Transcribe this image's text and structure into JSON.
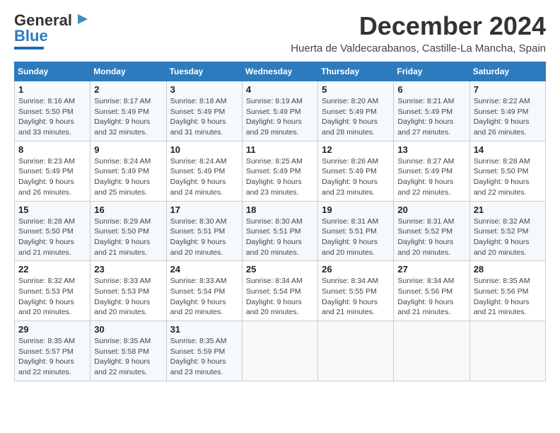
{
  "logo": {
    "line1": "General",
    "line2": "Blue"
  },
  "title": "December 2024",
  "subtitle": "Huerta de Valdecarabanos, Castille-La Mancha, Spain",
  "days_of_week": [
    "Sunday",
    "Monday",
    "Tuesday",
    "Wednesday",
    "Thursday",
    "Friday",
    "Saturday"
  ],
  "weeks": [
    [
      {
        "day": "1",
        "info": "Sunrise: 8:16 AM\nSunset: 5:50 PM\nDaylight: 9 hours\nand 33 minutes."
      },
      {
        "day": "2",
        "info": "Sunrise: 8:17 AM\nSunset: 5:49 PM\nDaylight: 9 hours\nand 32 minutes."
      },
      {
        "day": "3",
        "info": "Sunrise: 8:18 AM\nSunset: 5:49 PM\nDaylight: 9 hours\nand 31 minutes."
      },
      {
        "day": "4",
        "info": "Sunrise: 8:19 AM\nSunset: 5:49 PM\nDaylight: 9 hours\nand 29 minutes."
      },
      {
        "day": "5",
        "info": "Sunrise: 8:20 AM\nSunset: 5:49 PM\nDaylight: 9 hours\nand 28 minutes."
      },
      {
        "day": "6",
        "info": "Sunrise: 8:21 AM\nSunset: 5:49 PM\nDaylight: 9 hours\nand 27 minutes."
      },
      {
        "day": "7",
        "info": "Sunrise: 8:22 AM\nSunset: 5:49 PM\nDaylight: 9 hours\nand 26 minutes."
      }
    ],
    [
      {
        "day": "8",
        "info": "Sunrise: 8:23 AM\nSunset: 5:49 PM\nDaylight: 9 hours\nand 26 minutes."
      },
      {
        "day": "9",
        "info": "Sunrise: 8:24 AM\nSunset: 5:49 PM\nDaylight: 9 hours\nand 25 minutes."
      },
      {
        "day": "10",
        "info": "Sunrise: 8:24 AM\nSunset: 5:49 PM\nDaylight: 9 hours\nand 24 minutes."
      },
      {
        "day": "11",
        "info": "Sunrise: 8:25 AM\nSunset: 5:49 PM\nDaylight: 9 hours\nand 23 minutes."
      },
      {
        "day": "12",
        "info": "Sunrise: 8:26 AM\nSunset: 5:49 PM\nDaylight: 9 hours\nand 23 minutes."
      },
      {
        "day": "13",
        "info": "Sunrise: 8:27 AM\nSunset: 5:49 PM\nDaylight: 9 hours\nand 22 minutes."
      },
      {
        "day": "14",
        "info": "Sunrise: 8:28 AM\nSunset: 5:50 PM\nDaylight: 9 hours\nand 22 minutes."
      }
    ],
    [
      {
        "day": "15",
        "info": "Sunrise: 8:28 AM\nSunset: 5:50 PM\nDaylight: 9 hours\nand 21 minutes."
      },
      {
        "day": "16",
        "info": "Sunrise: 8:29 AM\nSunset: 5:50 PM\nDaylight: 9 hours\nand 21 minutes."
      },
      {
        "day": "17",
        "info": "Sunrise: 8:30 AM\nSunset: 5:51 PM\nDaylight: 9 hours\nand 20 minutes."
      },
      {
        "day": "18",
        "info": "Sunrise: 8:30 AM\nSunset: 5:51 PM\nDaylight: 9 hours\nand 20 minutes."
      },
      {
        "day": "19",
        "info": "Sunrise: 8:31 AM\nSunset: 5:51 PM\nDaylight: 9 hours\nand 20 minutes."
      },
      {
        "day": "20",
        "info": "Sunrise: 8:31 AM\nSunset: 5:52 PM\nDaylight: 9 hours\nand 20 minutes."
      },
      {
        "day": "21",
        "info": "Sunrise: 8:32 AM\nSunset: 5:52 PM\nDaylight: 9 hours\nand 20 minutes."
      }
    ],
    [
      {
        "day": "22",
        "info": "Sunrise: 8:32 AM\nSunset: 5:53 PM\nDaylight: 9 hours\nand 20 minutes."
      },
      {
        "day": "23",
        "info": "Sunrise: 8:33 AM\nSunset: 5:53 PM\nDaylight: 9 hours\nand 20 minutes."
      },
      {
        "day": "24",
        "info": "Sunrise: 8:33 AM\nSunset: 5:54 PM\nDaylight: 9 hours\nand 20 minutes."
      },
      {
        "day": "25",
        "info": "Sunrise: 8:34 AM\nSunset: 5:54 PM\nDaylight: 9 hours\nand 20 minutes."
      },
      {
        "day": "26",
        "info": "Sunrise: 8:34 AM\nSunset: 5:55 PM\nDaylight: 9 hours\nand 21 minutes."
      },
      {
        "day": "27",
        "info": "Sunrise: 8:34 AM\nSunset: 5:56 PM\nDaylight: 9 hours\nand 21 minutes."
      },
      {
        "day": "28",
        "info": "Sunrise: 8:35 AM\nSunset: 5:56 PM\nDaylight: 9 hours\nand 21 minutes."
      }
    ],
    [
      {
        "day": "29",
        "info": "Sunrise: 8:35 AM\nSunset: 5:57 PM\nDaylight: 9 hours\nand 22 minutes."
      },
      {
        "day": "30",
        "info": "Sunrise: 8:35 AM\nSunset: 5:58 PM\nDaylight: 9 hours\nand 22 minutes."
      },
      {
        "day": "31",
        "info": "Sunrise: 8:35 AM\nSunset: 5:59 PM\nDaylight: 9 hours\nand 23 minutes."
      },
      {
        "day": "",
        "info": ""
      },
      {
        "day": "",
        "info": ""
      },
      {
        "day": "",
        "info": ""
      },
      {
        "day": "",
        "info": ""
      }
    ]
  ]
}
